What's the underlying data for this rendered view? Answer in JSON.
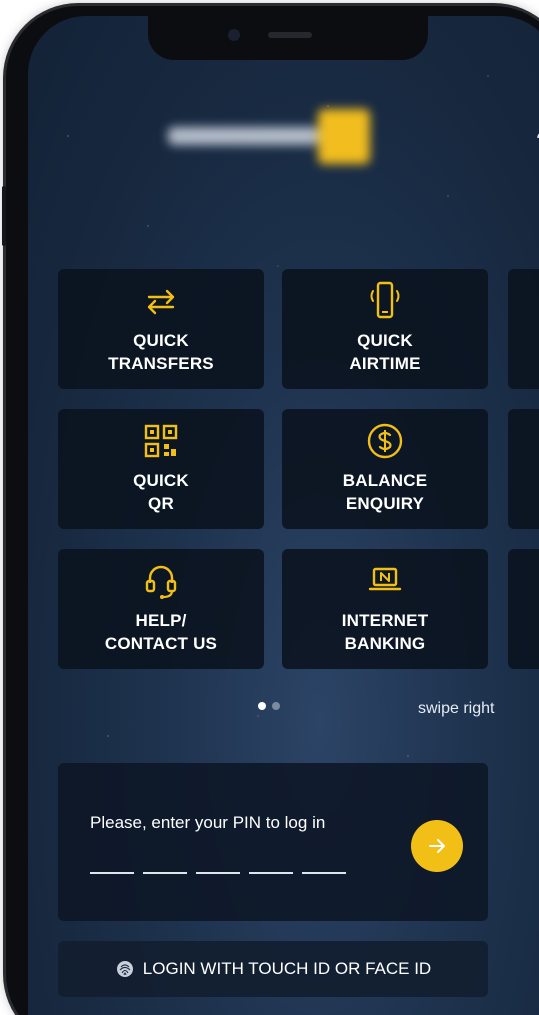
{
  "colors": {
    "accent": "#f2bf17",
    "tile_bg": "#0a121e",
    "background": "#1c2f4a"
  },
  "home": {
    "tiles": [
      {
        "label": "QUICK\nTRANSFERS",
        "icon": "transfer-arrows-icon"
      },
      {
        "label": "QUICK\nAIRTIME",
        "icon": "mobile-phone-icon"
      },
      {
        "label": "QUICK\nQR",
        "icon": "qr-code-icon"
      },
      {
        "label": "BALANCE\nENQUIRY",
        "icon": "dollar-coin-icon"
      },
      {
        "label": "HELP/\nCONTACT US",
        "icon": "headset-icon"
      },
      {
        "label": "INTERNET\nBANKING",
        "icon": "laptop-n-icon"
      }
    ],
    "pagination": {
      "pages": 2,
      "current": 1
    },
    "swipe_hint": "swipe right"
  },
  "login": {
    "pin_prompt": "Please, enter your PIN to log in",
    "pin_length": 5,
    "biometric_label": "LOGIN WITH TOUCH ID OR FACE ID"
  }
}
